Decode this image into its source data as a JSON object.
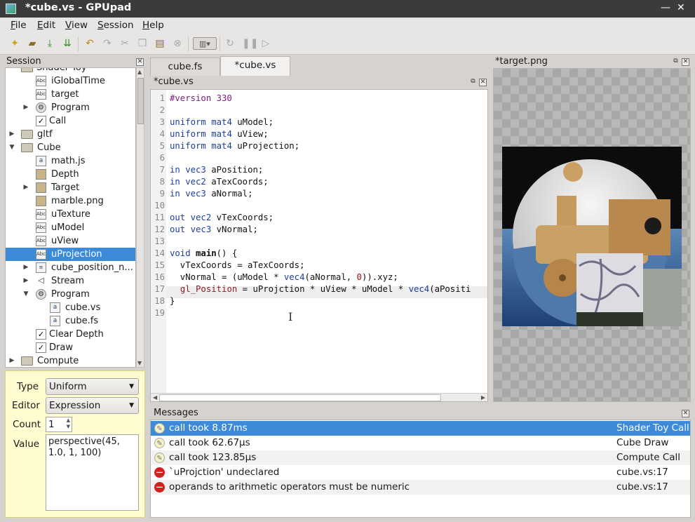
{
  "window": {
    "title": "*cube.vs - GPUpad",
    "minimize": "—",
    "close": "✕"
  },
  "menu": [
    {
      "mn": "F",
      "rest": "ile"
    },
    {
      "mn": "E",
      "rest": "dit"
    },
    {
      "mn": "V",
      "rest": "iew"
    },
    {
      "mn": "S",
      "rest": "ession"
    },
    {
      "mn": "H",
      "rest": "elp"
    }
  ],
  "toolbar_icons": [
    "new-file-icon",
    "open-file-icon",
    "save-icon",
    "save-all-icon",
    "undo-icon",
    "redo-icon",
    "cut-icon",
    "copy-icon",
    "paste-icon",
    "delete-icon",
    "source-type-icon",
    "reload-icon",
    "pause-icon",
    "run-icon"
  ],
  "session": {
    "title": "Session",
    "tree": [
      {
        "label": "Shader Toy",
        "icon": "folder"
      },
      {
        "label": "iGlobalTime",
        "icon": "binding"
      },
      {
        "label": "target",
        "icon": "binding"
      },
      {
        "label": "Program",
        "icon": "gear"
      },
      {
        "label": "Call",
        "icon": "check"
      },
      {
        "label": "gltf",
        "icon": "folder"
      },
      {
        "label": "Cube",
        "icon": "folder"
      },
      {
        "label": "math.js",
        "icon": "script"
      },
      {
        "label": "Depth",
        "icon": "image"
      },
      {
        "label": "Target",
        "icon": "target"
      },
      {
        "label": "marble.png",
        "icon": "image"
      },
      {
        "label": "uTexture",
        "icon": "binding"
      },
      {
        "label": "uModel",
        "icon": "binding"
      },
      {
        "label": "uView",
        "icon": "binding"
      },
      {
        "label": "uProjection",
        "icon": "binding"
      },
      {
        "label": "cube_position_n...",
        "icon": "buffer"
      },
      {
        "label": "Stream",
        "icon": "stream"
      },
      {
        "label": "Program",
        "icon": "gear"
      },
      {
        "label": "cube.vs",
        "icon": "script"
      },
      {
        "label": "cube.fs",
        "icon": "script"
      },
      {
        "label": "Clear Depth",
        "icon": "check"
      },
      {
        "label": "Draw",
        "icon": "check"
      },
      {
        "label": "Compute",
        "icon": "folder"
      }
    ]
  },
  "properties": {
    "type_label": "Type",
    "type_value": "Uniform",
    "editor_label": "Editor",
    "editor_value": "Expression",
    "count_label": "Count",
    "count_value": "1",
    "value_label": "Value",
    "value_text": "perspective(45,\n1.0, 1, 100)"
  },
  "tabs": [
    "cube.fs",
    "*cube.vs"
  ],
  "editor": {
    "title": "*cube.vs",
    "line_numbers": [
      "1",
      "2",
      "3",
      "4",
      "5",
      "6",
      "7",
      "8",
      "9",
      "10",
      "11",
      "12",
      "13",
      "14",
      "15",
      "16",
      "17",
      "18",
      "19"
    ],
    "lines": [
      "#version 330",
      "",
      "uniform mat4 uModel;",
      "uniform mat4 uView;",
      "uniform mat4 uProjection;",
      "",
      "in vec3 aPosition;",
      "in vec2 aTexCoords;",
      "in vec3 aNormal;",
      "",
      "out vec2 vTexCoords;",
      "out vec3 vNormal;",
      "",
      "void main() {",
      "  vTexCoords = aTexCoords;",
      "  vNormal = (uModel * vec4(aNormal, 0)).xyz;",
      "  gl_Position = uProjction * uView * uModel * vec4(aPositi",
      "}",
      ""
    ]
  },
  "target": {
    "title": "*target.png"
  },
  "messages": {
    "title": "Messages",
    "items": [
      {
        "text": "call took 8.87ms",
        "source": "Shader Toy Call",
        "kind": "info"
      },
      {
        "text": "call took 62.67µs",
        "source": "Cube Draw",
        "kind": "info"
      },
      {
        "text": "call took 123.85µs",
        "source": "Compute Call",
        "kind": "info"
      },
      {
        "text": "`uProjction' undeclared",
        "source": "cube.vs:17",
        "kind": "error"
      },
      {
        "text": "operands to arithmetic operators must be numeric",
        "source": "cube.vs:17",
        "kind": "error"
      }
    ]
  }
}
